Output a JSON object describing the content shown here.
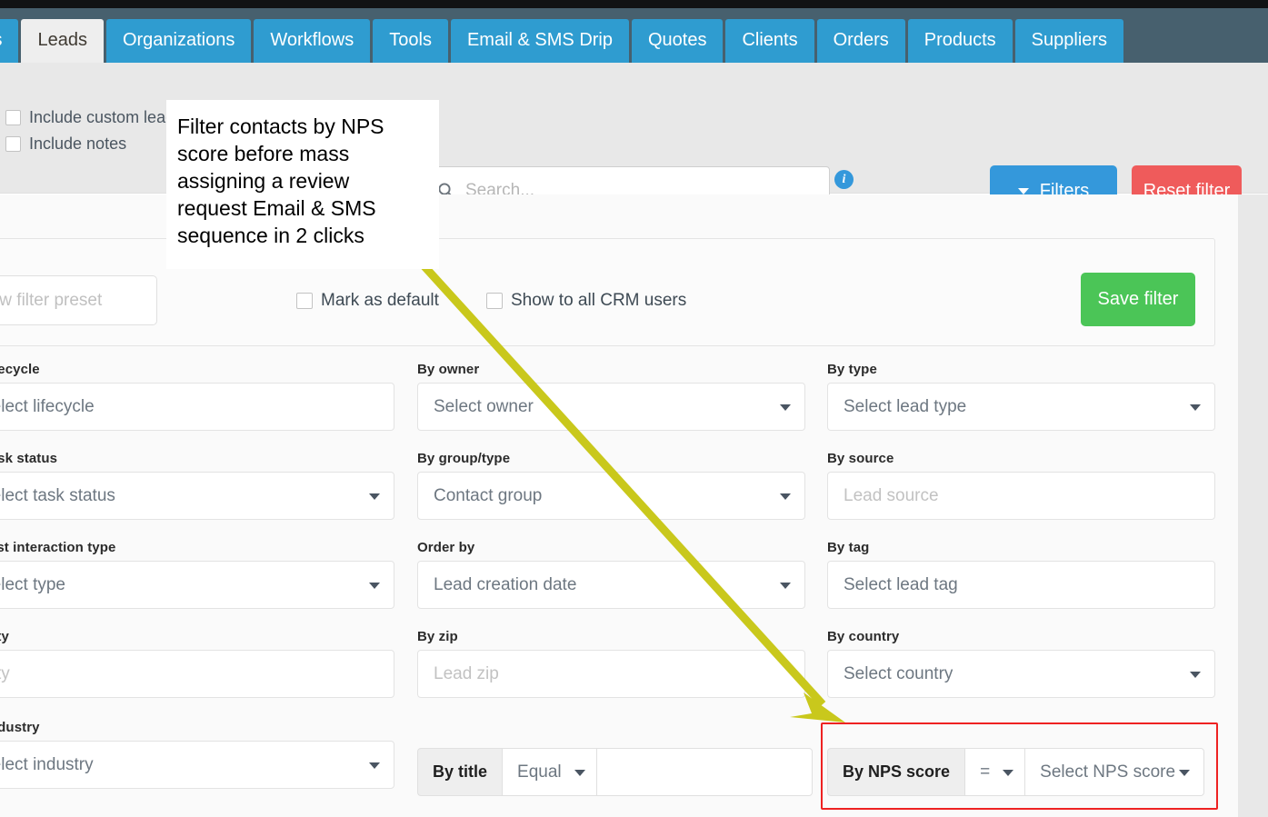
{
  "nav": {
    "tabs": [
      {
        "label": "ports",
        "active": false
      },
      {
        "label": "Leads",
        "active": true
      },
      {
        "label": "Organizations",
        "active": false
      },
      {
        "label": "Workflows",
        "active": false
      },
      {
        "label": "Tools",
        "active": false
      },
      {
        "label": "Email & SMS Drip",
        "active": false
      },
      {
        "label": "Quotes",
        "active": false
      },
      {
        "label": "Clients",
        "active": false
      },
      {
        "label": "Orders",
        "active": false
      },
      {
        "label": "Products",
        "active": false
      },
      {
        "label": "Suppliers",
        "active": false
      }
    ]
  },
  "toolbar": {
    "include_custom_label": "Include custom lead fields",
    "include_notes_label": "Include notes",
    "search_placeholder": "Search...",
    "search_value": "",
    "search_icon": "search-icon",
    "info_icon": "i",
    "filters_label": "Filters",
    "reset_label": "Reset filter"
  },
  "preset": {
    "name_placeholder": "New filter preset",
    "name_value": "",
    "mark_default_label": "Mark as default",
    "show_all_label": "Show to all CRM users",
    "save_label": "Save filter",
    "save_color": "#4bc557"
  },
  "filters": {
    "rows": [
      [
        {
          "label": "By lifecycle",
          "value": "Select lifecycle",
          "placeholder_style": "normal",
          "caret": false
        },
        {
          "label": "By owner",
          "value": "Select owner",
          "placeholder_style": "normal",
          "caret": true
        },
        {
          "label": "By type",
          "value": "Select lead type",
          "placeholder_style": "normal",
          "caret": true
        }
      ],
      [
        {
          "label": "By task status",
          "value": "Select task status",
          "placeholder_style": "normal",
          "caret": true
        },
        {
          "label": "By group/type",
          "value": "Contact group",
          "placeholder_style": "normal",
          "caret": true
        },
        {
          "label": "By source",
          "value": "Lead source",
          "placeholder_style": "light",
          "caret": false
        }
      ],
      [
        {
          "label": "By last interaction type",
          "value": "Select type",
          "placeholder_style": "normal",
          "caret": true
        },
        {
          "label": "Order by",
          "value": "Lead creation date",
          "placeholder_style": "normal",
          "caret": true
        },
        {
          "label": "By tag",
          "value": "Select lead tag",
          "placeholder_style": "normal",
          "caret": false
        }
      ],
      [
        {
          "label": "By city",
          "value": "City",
          "placeholder_style": "light",
          "caret": false
        },
        {
          "label": "By zip",
          "value": "Lead zip",
          "placeholder_style": "light",
          "caret": false
        },
        {
          "label": "By country",
          "value": "Select country",
          "placeholder_style": "normal",
          "caret": true
        }
      ]
    ],
    "industry": {
      "label": "By industry",
      "value": "Select industry",
      "caret": true
    },
    "title_group": {
      "addon": "By title",
      "operator": "Equal",
      "value": ""
    },
    "nps_group": {
      "addon": "By NPS score",
      "operator": "=",
      "value": "Select NPS score",
      "highlight_color": "#ee2222"
    }
  },
  "callout": {
    "text": "Filter contacts by NPS score before mass assigning a review request Email & SMS sequence in 2 clicks",
    "arrow_color": "#c9c81c"
  }
}
